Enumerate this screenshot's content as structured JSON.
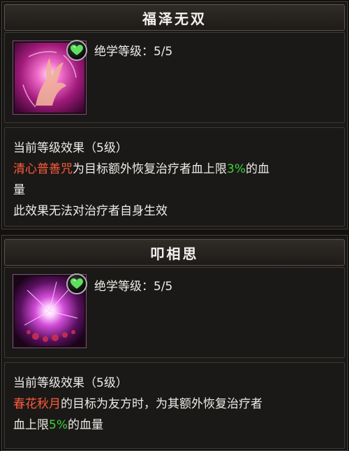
{
  "skills": [
    {
      "name": "福泽无双",
      "level_label": "绝学等级：",
      "level_value": "5/5",
      "effect_header": "当前等级效果（5级）",
      "effect_line1_skill": "清心普善咒",
      "effect_line1_mid": "为目标额外恢复治疗者血上限",
      "effect_line1_percent": "3%",
      "effect_line1_tail": "的血",
      "effect_line2": "量",
      "effect_line3": "此效果无法对治疗者自身生效",
      "icon": "glowing-hand-icon"
    },
    {
      "name": "叩相思",
      "level_label": "绝学等级：",
      "level_value": "5/5",
      "effect_header": "当前等级效果（5级）",
      "effect_line1_skill": "春花秋月",
      "effect_line1_mid": "的目标为友方时，为其额外恢复治疗者",
      "effect_line2_pre": "血上限",
      "effect_line2_percent": "5%",
      "effect_line2_tail": "的血量",
      "icon": "purple-burst-icon"
    }
  ],
  "colors": {
    "skill_name_red": "#ff5a3c",
    "percent_green": "#3bd43b",
    "heart_green": "#5fe05f"
  }
}
